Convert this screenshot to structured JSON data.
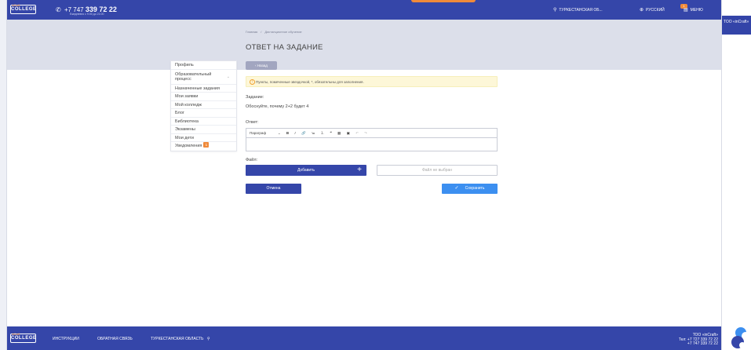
{
  "header": {
    "logo_text": "COLLEGE",
    "logo_sup": "inCraft",
    "phone_prefix": "+7 747",
    "phone_main": "339 72 22",
    "hours": "Ежедневно с 9:00 до 21:00",
    "region": "ТУРКЕСТАНСКАЯ ОБ...",
    "language": "РУССКИЙ",
    "menu": "МЕНЮ",
    "menu_badge": "1"
  },
  "breadcrumb": {
    "home": "Главная",
    "separator": "/",
    "current": "Дистанционное обучение"
  },
  "page_title": "ОТВЕТ НА ЗАДАНИЕ",
  "back_button": "Назад",
  "sidebar": {
    "items": [
      {
        "label": "Профиль"
      },
      {
        "label": "Образовательный процесс"
      },
      {
        "label": "Назначенные задания"
      },
      {
        "label": "Мои заявки"
      },
      {
        "label": "Мой колледж"
      },
      {
        "label": "Блог"
      },
      {
        "label": "Библиотека"
      },
      {
        "label": "Экзамены"
      },
      {
        "label": "Мои дети"
      },
      {
        "label": "Уведомления",
        "count": "1"
      }
    ]
  },
  "notice": "Пункты, помеченные звездочкой, *, обязательны для заполнения.",
  "task": {
    "label": "Задание:",
    "text": "Обоснуйте, почему 2+2 будет 4"
  },
  "answer": {
    "label": "Ответ:",
    "toolbar": {
      "paragraph": "Параграф",
      "bold": "B",
      "italic": "I",
      "link": "🔗",
      "bullets": "≔",
      "numbers": "⒈",
      "quote": "❝",
      "table": "▦",
      "media": "▣",
      "undo": "↶",
      "redo": "↷"
    }
  },
  "file": {
    "label": "Файл:",
    "add_button": "Добавить",
    "plus": "+",
    "no_file": "Файл не выбран"
  },
  "actions": {
    "cancel": "Отмена",
    "save": "Сохранить"
  },
  "footer": {
    "logo_text": "COLLEGE",
    "logo_sup": "inCraft",
    "links": [
      "ИНСТРУКЦИИ",
      "ОБРАТНАЯ СВЯЗЬ",
      "ТУРКЕСТАНСКАЯ ОБЛАСТЬ"
    ],
    "company": "ТОО «inCraft»",
    "tel1": "Тел: +7 727 339 72 22",
    "tel2": "+7 747 339 72 22"
  },
  "right_panel": {
    "company": "ТОО «inCraft»"
  },
  "colors": {
    "primary": "#3546a9",
    "accent": "#f08a3a",
    "save": "#3c8ff0",
    "band": "#dcdfea"
  },
  "icons": {
    "phone": "phone-icon",
    "location": "location-icon",
    "globe": "globe-icon",
    "menu": "menu-icon",
    "warning": "warning-icon",
    "check": "check-icon"
  }
}
